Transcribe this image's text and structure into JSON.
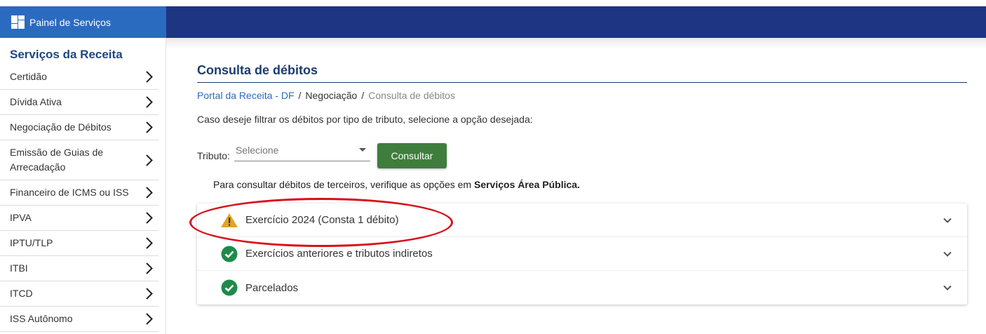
{
  "header": {
    "brand_label": "Painel de Serviços"
  },
  "sidebar": {
    "title": "Serviços da Receita",
    "items": [
      {
        "label": "Certidão"
      },
      {
        "label": "Dívida Ativa"
      },
      {
        "label": "Negociação de Débitos"
      },
      {
        "label": "Emissão de Guias de Arrecadação"
      },
      {
        "label": "Financeiro de ICMS ou ISS"
      },
      {
        "label": "IPVA"
      },
      {
        "label": "IPTU/TLP"
      },
      {
        "label": "ITBI"
      },
      {
        "label": "ITCD"
      },
      {
        "label": "ISS Autônomo"
      }
    ]
  },
  "main": {
    "title": "Consulta de débitos",
    "breadcrumb": {
      "root": "Portal da Receita - DF",
      "parent": "Negociação",
      "current": "Consulta de débitos",
      "separator": "/"
    },
    "hint": "Caso deseje filtrar os débitos por tipo de tributo, selecione a opção desejada:",
    "filter": {
      "label": "Tributo:",
      "placeholder": "Selecione",
      "button": "Consultar"
    },
    "note": {
      "text": "Para consultar débitos de terceiros, verifique as opções em ",
      "bold": "Serviços Área Pública."
    },
    "accordion": [
      {
        "label": "Exercício 2024  (Consta 1 débito)",
        "status_icon": "warning-icon"
      },
      {
        "label": "Exercícios anteriores e tributos indiretos",
        "status_icon": "check-circle-icon"
      },
      {
        "label": "Parcelados",
        "status_icon": "check-circle-icon"
      }
    ]
  },
  "colors": {
    "topbar": "#1e3583",
    "brand": "#2a6bc0",
    "button": "#3e7d3c",
    "warning": "#e0a526",
    "success": "#1f8a4a",
    "highlight": "#d8101a"
  }
}
